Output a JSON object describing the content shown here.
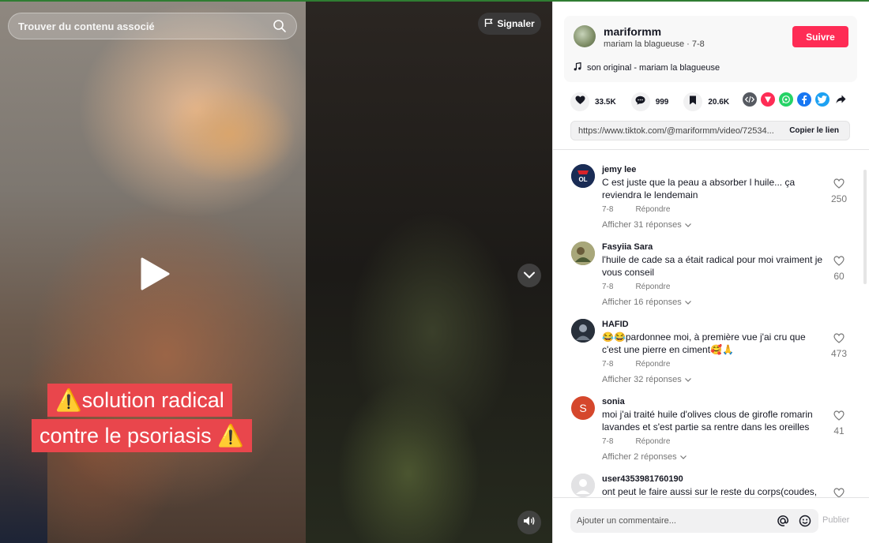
{
  "search": {
    "placeholder": "Trouver du contenu associé"
  },
  "video": {
    "report_label": "Signaler",
    "caption_line1": "⚠️solution radical",
    "caption_line2": "contre le psoriasis ⚠️"
  },
  "author": {
    "username": "mariformm",
    "subtitle": "mariam la blagueuse · 7-8",
    "follow_label": "Suivre",
    "music": "son original - mariam la blagueuse"
  },
  "actions": {
    "likes": "33.5K",
    "comments": "999",
    "saves": "20.6K"
  },
  "share_icons": [
    "embed-icon",
    "send-icon",
    "whatsapp-icon",
    "facebook-icon",
    "twitter-icon",
    "share-arrow-icon"
  ],
  "link": {
    "url": "https://www.tiktok.com/@mariformm/video/72534...",
    "copy_label": "Copier le lien"
  },
  "comments": [
    {
      "user": "jemy lee",
      "text": "C est juste que la peau a absorber l huile... ça reviendra le lendemain",
      "date": "7-8",
      "reply_label": "Répondre",
      "more_label": "Afficher 31 réponses",
      "likes": "250",
      "avatar_color": "#1c2a4a"
    },
    {
      "user": "Fasyiia Sara",
      "text": "l'huile de cade sa a était radical pour moi vraiment je vous conseil",
      "date": "7-8",
      "reply_label": "Répondre",
      "more_label": "Afficher 16 réponses",
      "likes": "60",
      "avatar_color": "#8d8b5e"
    },
    {
      "user": "HAFID",
      "text": "😂😂pardonnee moi, à première vue j'ai cru que c'est une pierre en ciment🥰🙏",
      "date": "7-8",
      "reply_label": "Répondre",
      "more_label": "Afficher 32 réponses",
      "likes": "473",
      "avatar_color": "#2d3440"
    },
    {
      "user": "sonia",
      "text": "moi j'ai traité huile d'olives clous de girofle romarin lavandes et s'est partie sa rentre dans les oreilles",
      "date": "7-8",
      "reply_label": "Répondre",
      "more_label": "Afficher 2 réponses",
      "likes": "41",
      "avatar_letter": "S",
      "avatar_color": "#d5472c"
    },
    {
      "user": "user4353981760190",
      "text": "ont peut le faire aussi sur le reste du corps(coudes,",
      "avatar_color": "#d6d6d8"
    }
  ],
  "footer": {
    "placeholder": "Ajouter un commentaire...",
    "publish_label": "Publier"
  }
}
